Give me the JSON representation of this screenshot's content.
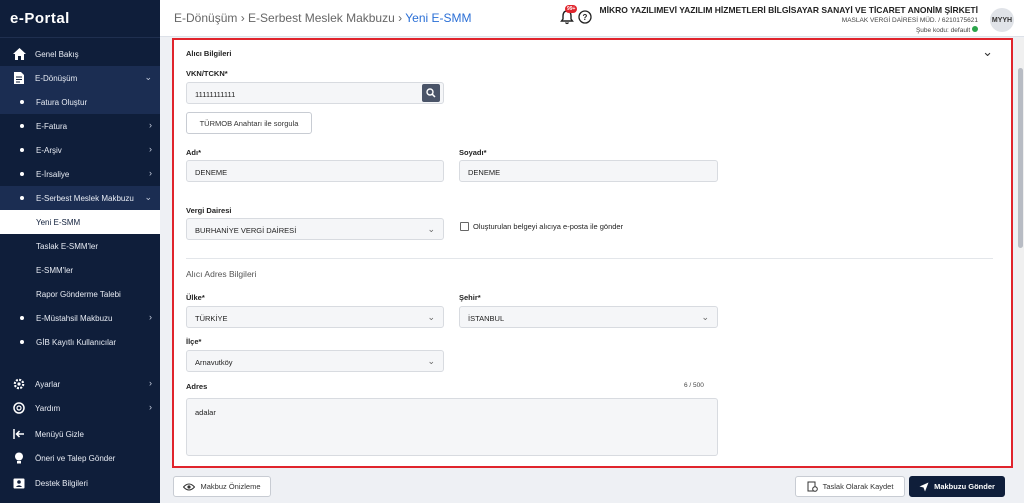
{
  "app": {
    "logo": "e-Portal"
  },
  "sidebar": {
    "items": [
      {
        "label": "Genel Bakış"
      },
      {
        "label": "E-Dönüşüm"
      },
      {
        "label": "Fatura Oluştur"
      },
      {
        "label": "E-Fatura"
      },
      {
        "label": "E-Arşiv"
      },
      {
        "label": "E-İrsaliye"
      },
      {
        "label": "E-Serbest Meslek Makbuzu"
      },
      {
        "label": "Yeni E-SMM"
      },
      {
        "label": "Taslak E-SMM'ler"
      },
      {
        "label": "E-SMM'ler"
      },
      {
        "label": "Rapor Gönderme Talebi"
      },
      {
        "label": "E-Müstahsil Makbuzu"
      },
      {
        "label": "GİB Kayıtlı Kullanıcılar"
      },
      {
        "label": "Ayarlar"
      },
      {
        "label": "Yardım"
      },
      {
        "label": "Menüyü Gizle"
      },
      {
        "label": "Öneri ve Talep Gönder"
      },
      {
        "label": "Destek Bilgileri"
      }
    ]
  },
  "header": {
    "crumb1": "E-Dönüşüm",
    "sep": "›",
    "crumb2": "E-Serbest Meslek Makbuzu",
    "crumb3": "Yeni E-SMM",
    "notif_count": "99+",
    "company": "MİKRO YAZILIMEVİ YAZILIM HİZMETLERİ BİLGİSAYAR SANAYİ VE TİCARET ANONİM ŞİRKETİ",
    "tax_office": "MASLAK VERGİ DAİRESİ MÜD. / 6210175621",
    "branch": "Şube kodu: default",
    "avatar": "MYYH"
  },
  "form": {
    "section_title": "Alıcı Bilgileri",
    "vkn_label": "VKN/TCKN*",
    "vkn_value": "11111111111",
    "turmob_button": "TÜRMOB Anahtarı ile sorgula",
    "name_label": "Adı*",
    "name_value": "DENEME",
    "surname_label": "Soyadı*",
    "surname_value": "DENEME",
    "tax_office_label": "Vergi Dairesi",
    "tax_office_value": "BURHANİYE VERGİ DAİRESİ",
    "email_checkbox_label": "Oluşturulan belgeyi alıcıya e-posta ile gönder",
    "address_section": "Alıcı Adres Bilgileri",
    "country_label": "Ülke*",
    "country_value": "TÜRKİYE",
    "city_label": "Şehir*",
    "city_value": "İSTANBUL",
    "district_label": "İlçe*",
    "district_value": "Arnavutköy",
    "address_label": "Adres",
    "address_count": "6 / 500",
    "address_value": "adalar"
  },
  "footer": {
    "preview_button": "Makbuz Önizleme",
    "draft_button": "Taslak Olarak Kaydet",
    "send_button": "Makbuzu Gönder"
  }
}
